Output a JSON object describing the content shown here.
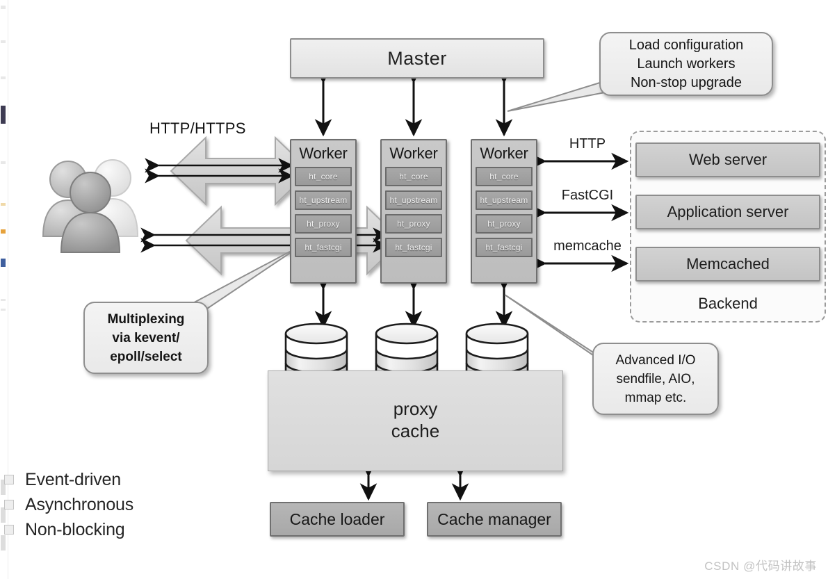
{
  "title": "nginx architecture",
  "master": {
    "label": "Master"
  },
  "callouts": {
    "master": {
      "name": "master-callout",
      "lines": [
        "Load configuration",
        "Launch workers",
        "Non-stop upgrade"
      ]
    },
    "multiplexing": {
      "name": "multiplexing-callout",
      "lines": [
        "Multiplexing",
        "via kevent/",
        "epoll/select"
      ]
    },
    "advanced_io": {
      "name": "advanced-io-callout",
      "lines": [
        "Advanced I/O",
        "sendfile, AIO,",
        "mmap etc."
      ]
    }
  },
  "workers": [
    {
      "title": "Worker",
      "modules": [
        "ht_core",
        "ht_upstream",
        "ht_proxy",
        "ht_fastcgi"
      ]
    },
    {
      "title": "Worker",
      "modules": [
        "ht_core",
        "ht_upstream",
        "ht_proxy",
        "ht_fastcgi"
      ]
    },
    {
      "title": "Worker",
      "modules": [
        "ht_core",
        "ht_upstream",
        "ht_proxy",
        "ht_fastcgi"
      ]
    }
  ],
  "client": {
    "icon": "users-group-icon",
    "protocol_label": "HTTP/HTTPS"
  },
  "protocols": {
    "http": "HTTP",
    "fastcgi": "FastCGI",
    "memcache": "memcache"
  },
  "backend": {
    "group_label": "Backend",
    "services": [
      "Web server",
      "Application server",
      "Memcached"
    ]
  },
  "cache": {
    "store_label": "proxy\ncache",
    "store_label_line1": "proxy",
    "store_label_line2": "cache",
    "disks": [
      "cache-disk-1",
      "cache-disk-2",
      "cache-disk-3"
    ],
    "loader": "Cache loader",
    "manager": "Cache manager"
  },
  "legend": {
    "items": [
      "Event-driven",
      "Asynchronous",
      "Non-blocking"
    ]
  },
  "watermark": "CSDN @代码讲故事",
  "colors": {
    "background": "#ffffff",
    "box_light": "#ecECec",
    "box_mid": "#cccccc",
    "box_dark": "#ababab",
    "module_fill": "#9f9f9f",
    "stroke": "#7a7a7a",
    "arrow": "#111111",
    "watermark": "#c2c2c2"
  }
}
